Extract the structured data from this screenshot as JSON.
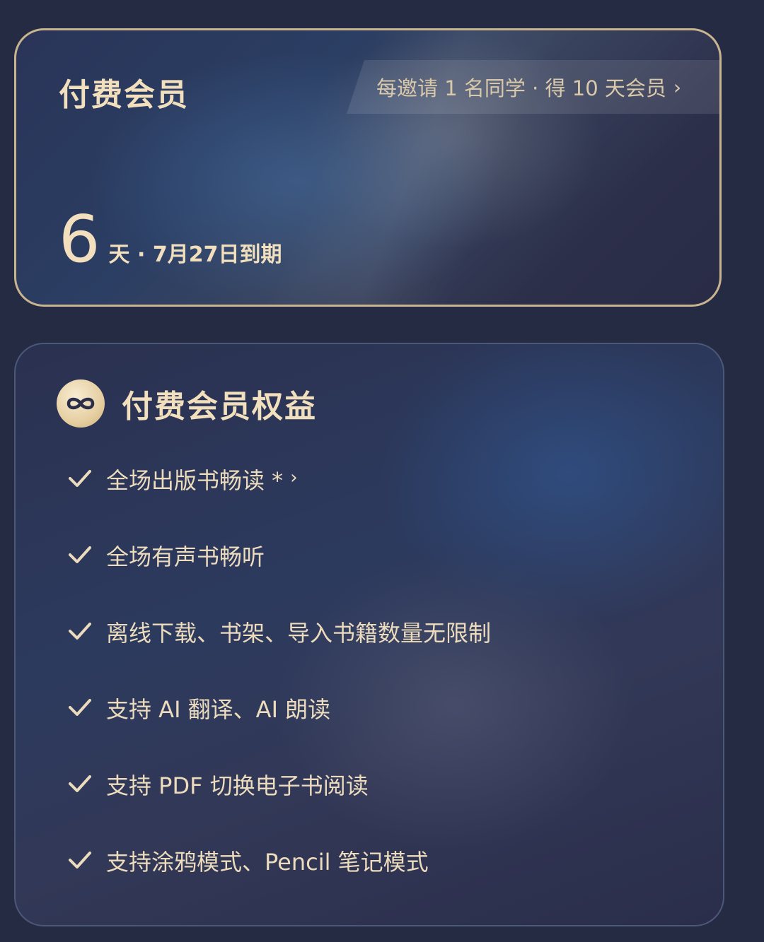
{
  "status_card": {
    "title": "付费会员",
    "invite_banner": "每邀请 1 名同学 · 得 10 天会员",
    "invite_chevron": "›",
    "days_remaining": "6",
    "expiry_text": "天 · 7月27日到期"
  },
  "benefits_card": {
    "badge_icon": "infinity-icon",
    "title": "付费会员权益",
    "items": [
      {
        "label": "全场出版书畅读 *",
        "chevron": "›"
      },
      {
        "label": "全场有声书畅听"
      },
      {
        "label": "离线下载、书架、导入书籍数量无限制"
      },
      {
        "label": "支持 AI 翻译、AI 朗读"
      },
      {
        "label": "支持 PDF 切换电子书阅读"
      },
      {
        "label": "支持涂鸦模式、Pencil 笔记模式"
      }
    ]
  },
  "colors": {
    "background": "#262b44",
    "gold_text": "#f1dfbd",
    "card_border_gold": "#c8b48f",
    "card_border_blue": "#4b5878"
  }
}
